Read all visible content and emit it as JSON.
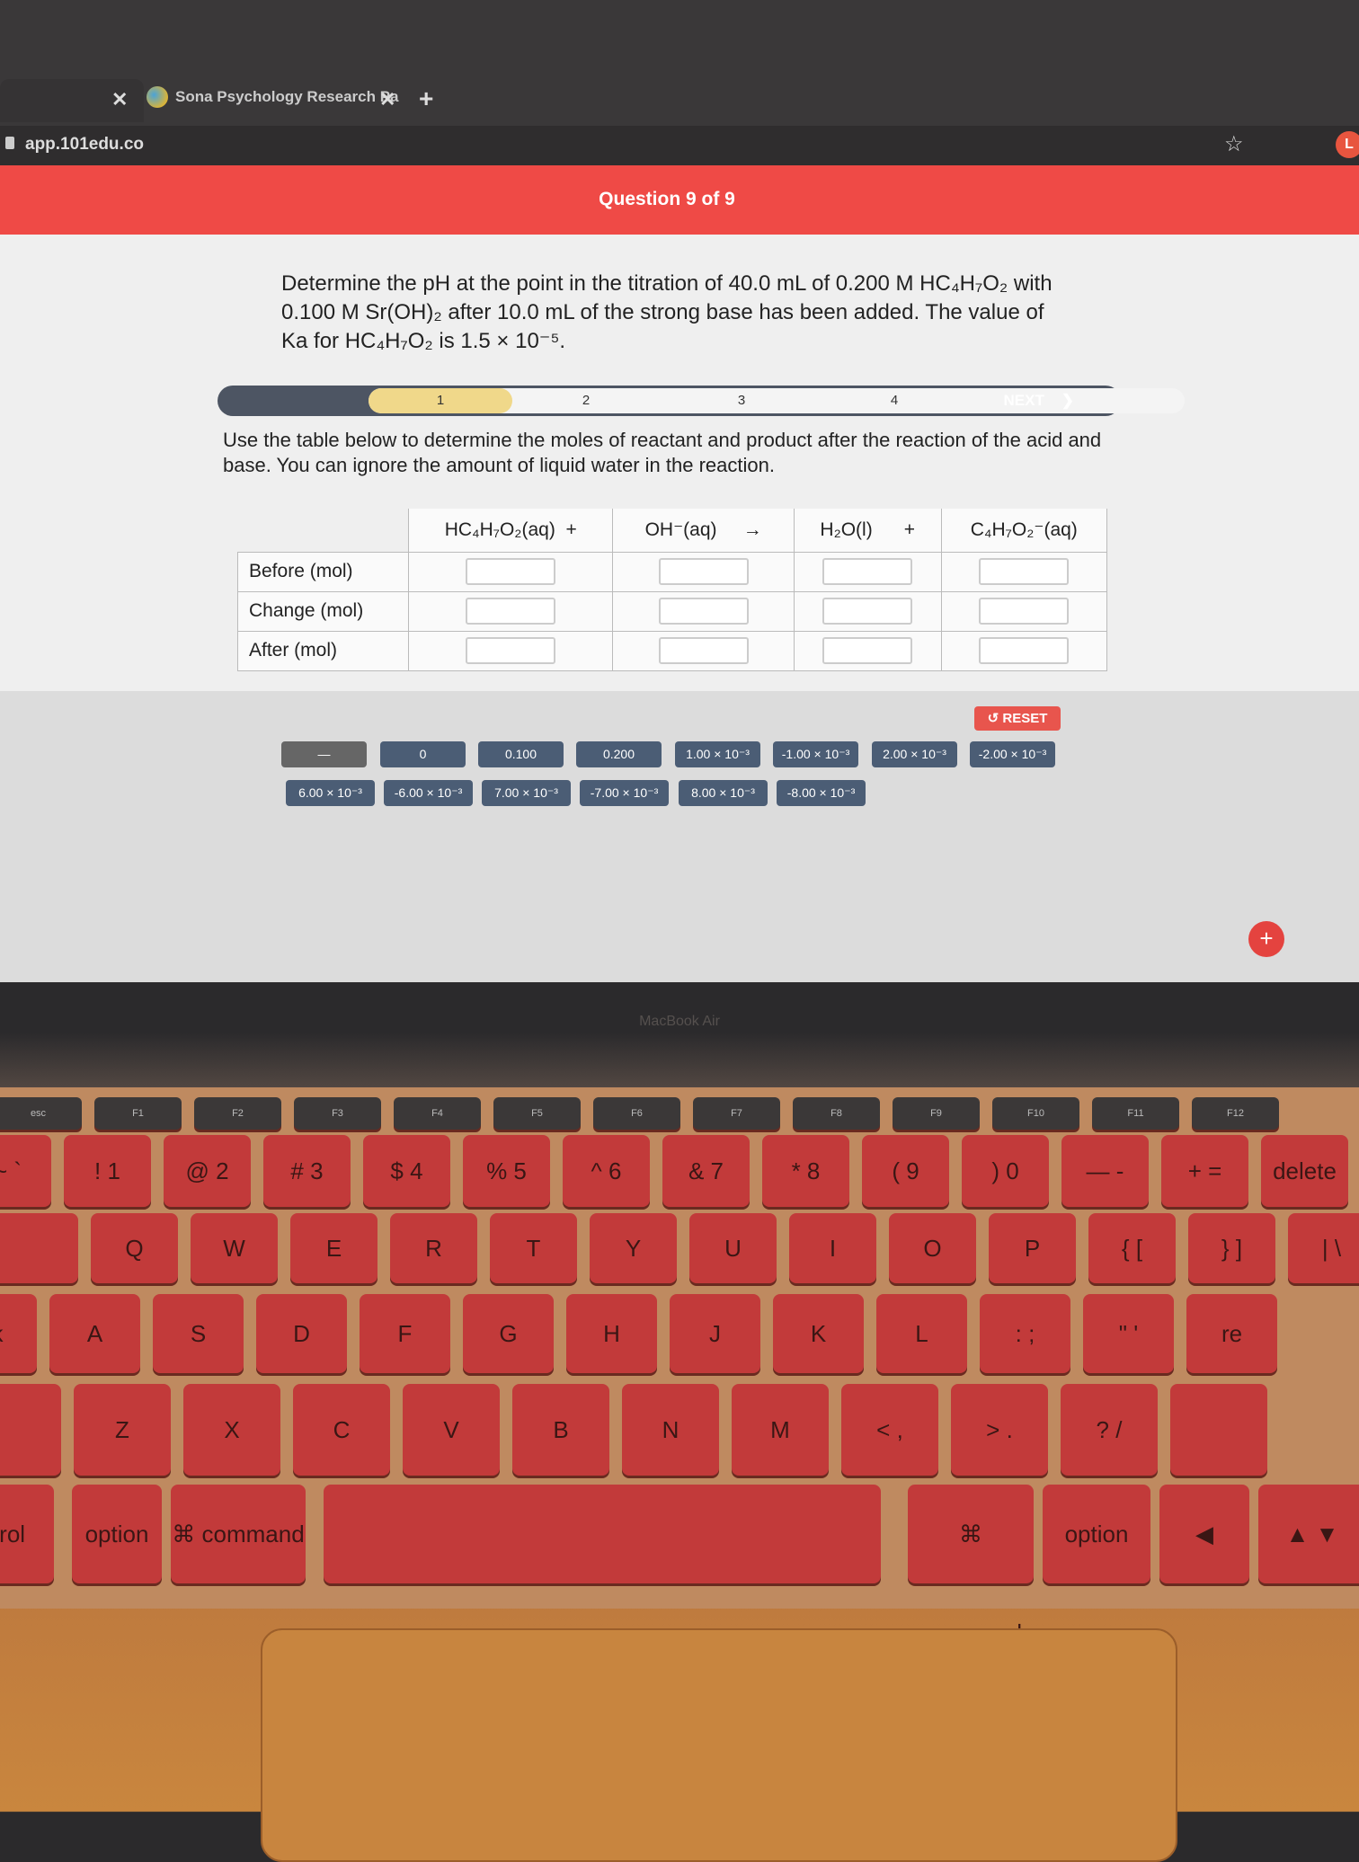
{
  "browser": {
    "tabs": [
      {
        "label": "",
        "close": "✕"
      },
      {
        "label": "Sona Psychology Research Pa",
        "close": "✕"
      }
    ],
    "new_tab": "+",
    "url": "app.101edu.co",
    "star_icon": "☆",
    "avatar_letter": "L"
  },
  "header": {
    "title": "Question 9 of 9",
    "color": "#ef4a46"
  },
  "question": {
    "line1": "Determine the pH at the point in the titration of 40.0 mL of 0.200 M HC₄H₇O₂ with",
    "line2": "0.100 M Sr(OH)₂ after 10.0 mL of the strong base has been added. The value of",
    "line3": "Ka for HC₄H₇O₂ is 1.5 × 10⁻⁵."
  },
  "progress": {
    "steps": [
      "1",
      "2",
      "3",
      "4"
    ],
    "current": "1",
    "next": "NEXT",
    "next_icon": "❯"
  },
  "instruction": "Use the table below to determine the moles of reactant and product after the reaction of the acid and base. You can ignore the amount of liquid water in the reaction.",
  "table": {
    "headers": [
      "HC₄H₇O₂(aq)",
      "+",
      "OH⁻(aq)",
      "→",
      "H₂O(l)",
      "+",
      "C₄H₇O₂⁻(aq)"
    ],
    "rows": [
      "Before (mol)",
      "Change (mol)",
      "After (mol)"
    ]
  },
  "reset": "RESET",
  "tiles": {
    "row1": [
      "—",
      "0",
      "0.100",
      "0.200",
      "1.00 × 10⁻³",
      "-1.00 × 10⁻³",
      "2.00 × 10⁻³",
      "-2.00 × 10⁻³"
    ],
    "row2": [
      "6.00 × 10⁻³",
      "-6.00 × 10⁻³",
      "7.00 × 10⁻³",
      "-7.00 × 10⁻³",
      "8.00 × 10⁻³",
      "-8.00 × 10⁻³"
    ]
  },
  "add_button": "+",
  "laptop": {
    "brand": "MacBook Air"
  },
  "keyboard": {
    "fn": [
      "esc",
      "F1",
      "F2",
      "F3",
      "F4",
      "F5",
      "F6",
      "F7",
      "F8",
      "F9",
      "F10",
      "F11",
      "F12"
    ],
    "num": [
      "~ `",
      "! 1",
      "@ 2",
      "# 3",
      "$ 4",
      "% 5",
      "^ 6",
      "& 7",
      "* 8",
      "( 9",
      ") 0",
      "— -",
      "+ =",
      "delete"
    ],
    "q": [
      "",
      "Q",
      "W",
      "E",
      "R",
      "T",
      "Y",
      "U",
      "I",
      "O",
      "P",
      "{ [",
      "} ]",
      "| \\"
    ],
    "a": [
      "ck",
      "A",
      "S",
      "D",
      "F",
      "G",
      "H",
      "J",
      "K",
      "L",
      ": ;",
      "\" '",
      "re"
    ],
    "z": [
      "",
      "Z",
      "X",
      "C",
      "V",
      "B",
      "N",
      "M",
      "< ,",
      "> .",
      "? /",
      ""
    ],
    "bottom": [
      "trol",
      "option",
      "⌘ command",
      "",
      "⌘ command",
      "option",
      "◀",
      "▲ ▼"
    ]
  }
}
